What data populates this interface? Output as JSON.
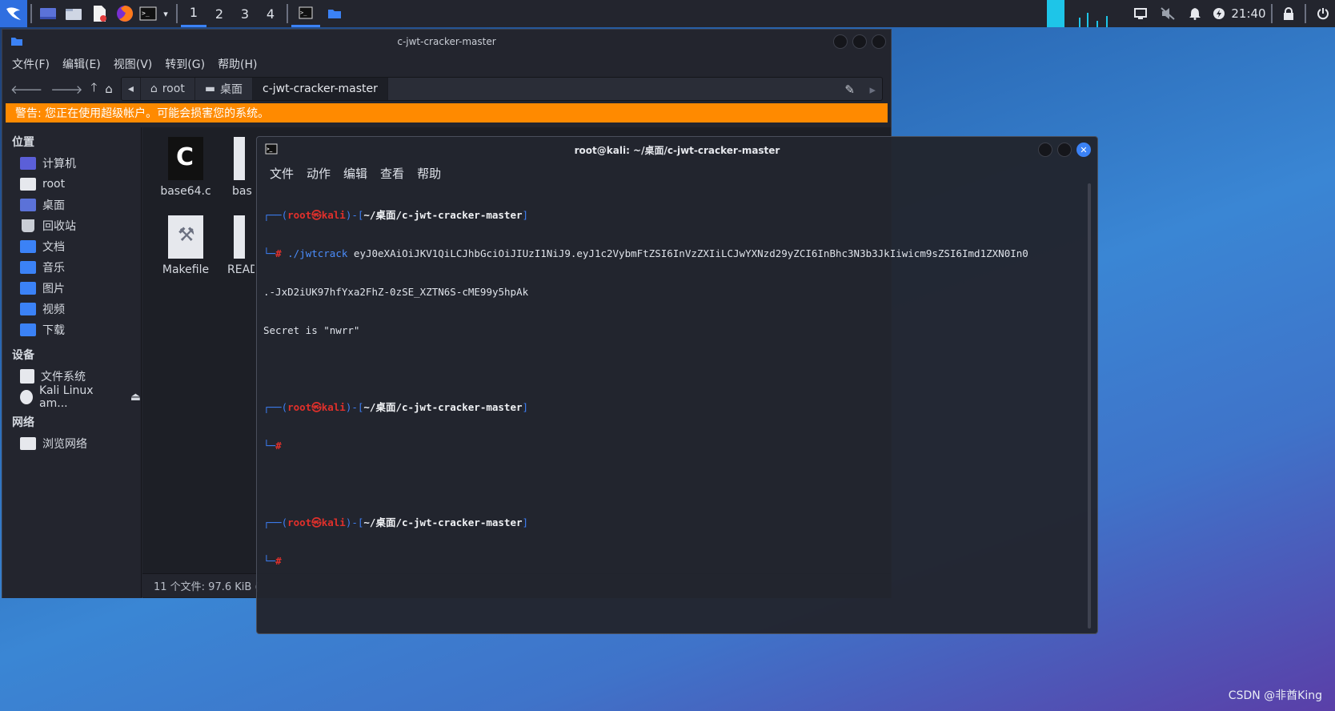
{
  "taskbar": {
    "workspaces": [
      "1",
      "2",
      "3",
      "4"
    ],
    "active_workspace": "1",
    "clock": "21:40",
    "accent": "#3b82f6"
  },
  "file_manager": {
    "title": "c-jwt-cracker-master",
    "menu": [
      "文件(F)",
      "编辑(E)",
      "视图(V)",
      "转到(G)",
      "帮助(H)"
    ],
    "breadcrumbs": [
      "root",
      "桌面",
      "c-jwt-cracker-master"
    ],
    "warning": "警告: 您正在使用超级帐户。可能会损害您的系统。",
    "warning_color": "#ff8a00",
    "sidebar": {
      "places_header": "位置",
      "places": [
        "计算机",
        "root",
        "桌面",
        "回收站",
        "文档",
        "音乐",
        "图片",
        "视频",
        "下载"
      ],
      "devices_header": "设备",
      "devices": [
        "文件系统",
        "Kali Linux am..."
      ],
      "network_header": "网络",
      "network": [
        "浏览网络"
      ]
    },
    "files": [
      "base64.c",
      "bas",
      "Makefile",
      "READ"
    ],
    "status": "11 个文件: 97.6 KiB ("
  },
  "terminal": {
    "title": "root@kali: ~/桌面/c-jwt-cracker-master",
    "menu": [
      "文件",
      "动作",
      "编辑",
      "查看",
      "帮助"
    ],
    "prompt_user": "root㉿kali",
    "prompt_path": "~/桌面/c-jwt-cracker-master",
    "command": "./jwtcrack",
    "token_line1": "eyJ0eXAiOiJKV1QiLCJhbGciOiJIUzI1NiJ9.eyJ1c2VybmFtZSI6InVzZXIiLCJwYXNzd29yZCI6InBhc3N3b3JkIiwicm9sZSI6Imd1ZXN0In0",
    "token_line2": ".-JxD2iUK97hfYxa2FhZ-0zSE_XZTN6S-cME99y5hpAk",
    "output": "Secret is \"nwrr\""
  },
  "watermark": "CSDN @非酋King"
}
